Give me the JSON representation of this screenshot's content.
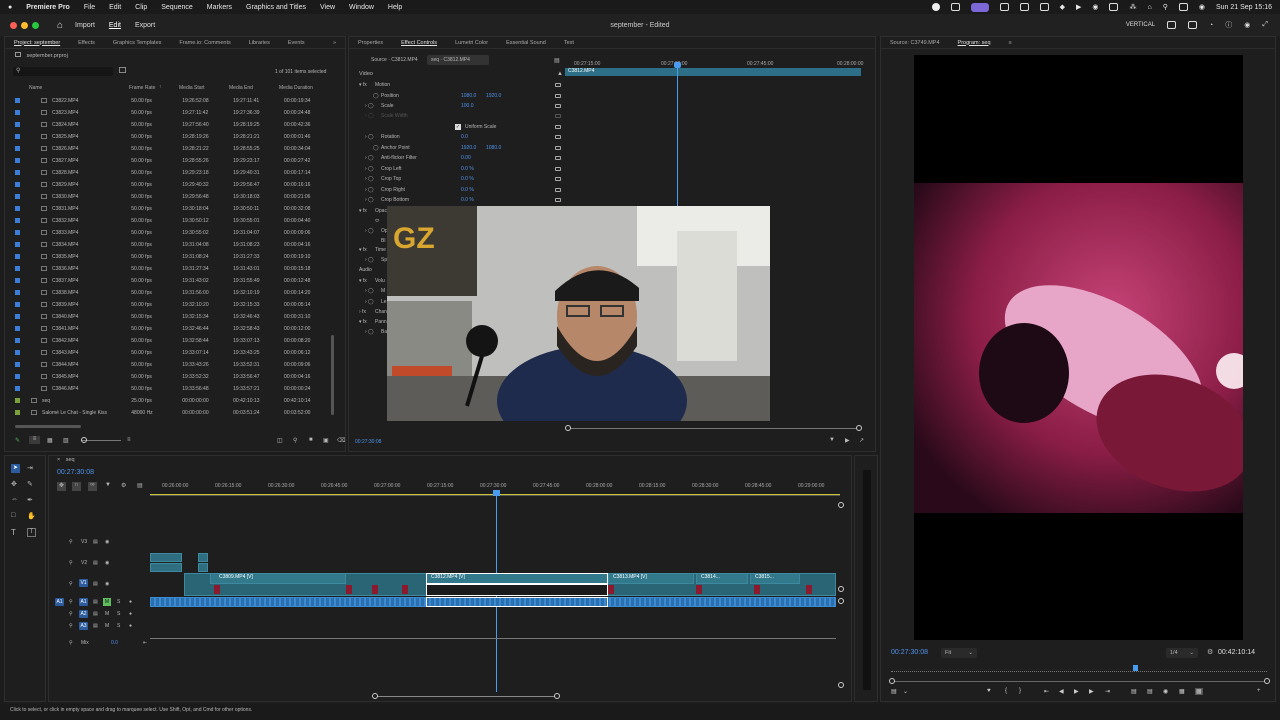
{
  "menubar": {
    "app": "Premiere Pro",
    "items": [
      "File",
      "Edit",
      "Clip",
      "Sequence",
      "Markers",
      "Graphics and Titles",
      "View",
      "Window",
      "Help"
    ],
    "clock": "Sun 21 Sep  15:16"
  },
  "titlebar": {
    "workspaces": [
      "Import",
      "Edit",
      "Export"
    ],
    "active_workspace": "Edit",
    "title": "september - Edited",
    "layout_label": "VERTICAL"
  },
  "project": {
    "tabs": [
      "Project: september",
      "Effects",
      "Graphics Templates",
      "Frame.io: Comments",
      "Libraries",
      "Events"
    ],
    "file": "september.prproj",
    "items_count": "1 of 101 items selected",
    "columns": [
      "Name",
      "Frame Rate",
      "Media Start",
      "Media End",
      "Media Duration"
    ],
    "rows": [
      [
        "C3822.MP4",
        "50.00 fps",
        "19:26:52:08",
        "19:27:11:41",
        "00:00:19:34"
      ],
      [
        "C3823.MP4",
        "50.00 fps",
        "19:27:11:42",
        "19:27:36:39",
        "00:00:24:48"
      ],
      [
        "C3824.MP4",
        "50.00 fps",
        "19:27:56:40",
        "19:28:19:25",
        "00:00:42:36"
      ],
      [
        "C3825.MP4",
        "50.00 fps",
        "19:28:19:26",
        "19:28:21:21",
        "00:00:01:46"
      ],
      [
        "C3826.MP4",
        "50.00 fps",
        "19:28:21:22",
        "19:28:55:25",
        "00:00:34:04"
      ],
      [
        "C3827.MP4",
        "50.00 fps",
        "19:28:55:26",
        "19:29:23:17",
        "00:00:27:42"
      ],
      [
        "C3828.MP4",
        "50.00 fps",
        "19:29:23:18",
        "19:29:40:31",
        "00:00:17:14"
      ],
      [
        "C3829.MP4",
        "50.00 fps",
        "19:29:40:32",
        "19:29:56:47",
        "00:00:16:16"
      ],
      [
        "C3830.MP4",
        "50.00 fps",
        "19:29:56:48",
        "19:30:18:03",
        "00:00:21:06"
      ],
      [
        "C3831.MP4",
        "50.00 fps",
        "19:30:18:04",
        "19:30:50:11",
        "00:00:32:08"
      ],
      [
        "C3832.MP4",
        "50.00 fps",
        "19:30:50:12",
        "19:30:55:01",
        "00:00:04:40"
      ],
      [
        "C3833.MP4",
        "50.00 fps",
        "19:30:55:02",
        "19:31:04:07",
        "00:00:09:06"
      ],
      [
        "C3834.MP4",
        "50.00 fps",
        "19:31:04:08",
        "19:31:08:23",
        "00:00:04:16"
      ],
      [
        "C3835.MP4",
        "50.00 fps",
        "19:31:08:24",
        "19:31:27:33",
        "00:00:19:10"
      ],
      [
        "C3836.MP4",
        "50.00 fps",
        "19:31:27:34",
        "19:31:43:01",
        "00:00:15:18"
      ],
      [
        "C3837.MP4",
        "50.00 fps",
        "19:31:43:02",
        "19:31:55:49",
        "00:00:12:48"
      ],
      [
        "C3838.MP4",
        "50.00 fps",
        "19:31:56:00",
        "19:32:10:19",
        "00:00:14:20"
      ],
      [
        "C3839.MP4",
        "50.00 fps",
        "19:32:10:20",
        "19:32:15:33",
        "00:00:05:14"
      ],
      [
        "C3840.MP4",
        "50.00 fps",
        "19:32:15:34",
        "19:32:46:43",
        "00:00:31:10"
      ],
      [
        "C3841.MP4",
        "50.00 fps",
        "19:32:46:44",
        "19:32:58:43",
        "00:00:12:00"
      ],
      [
        "C3842.MP4",
        "50.00 fps",
        "19:32:58:44",
        "19:33:07:13",
        "00:00:08:20"
      ],
      [
        "C3843.MP4",
        "50.00 fps",
        "19:33:07:14",
        "19:33:43:25",
        "00:00:06:12"
      ],
      [
        "C3844.MP4",
        "50.00 fps",
        "19:33:43:26",
        "19:33:52:31",
        "00:00:09:06"
      ],
      [
        "C3845.MP4",
        "50.00 fps",
        "19:33:52:32",
        "19:33:56:47",
        "00:00:04:16"
      ],
      [
        "C3846.MP4",
        "50.00 fps",
        "19:33:56:48",
        "19:33:57:21",
        "00:00:00:24"
      ],
      [
        "seq",
        "25.00 fps",
        "00:00:00:00",
        "00:42:10:13",
        "00:42:10:14"
      ],
      [
        "Salomé Le Chat - Single Kiss",
        "48000 Hz",
        "00:00:00:00",
        "00:03:51:24",
        "00:03:52:00"
      ]
    ]
  },
  "effect_controls": {
    "tabs": [
      "Properties",
      "Effect Controls",
      "Lumetri Color",
      "Essential Sound",
      "Text"
    ],
    "source_tab": "Source · C3812.MP4",
    "seq_tab": "seq · C3812.MP4",
    "clip_label": "C3812.MP4",
    "ruler": [
      "00:27:15:00",
      "00:27:30:00",
      "00:27:45:00",
      "00:28:00:00"
    ],
    "section_video": "Video",
    "section_audio": "Audio",
    "motion": "Motion",
    "position_label": "Position",
    "position_x": "1080.0",
    "position_y": "1920.0",
    "scale_label": "Scale",
    "scale_value": "100.0",
    "scale_width_label": "Scale Width",
    "uniform_scale": "Uniform Scale",
    "rotation_label": "Rotation",
    "rotation_value": "0.0",
    "anchor_label": "Anchor Point",
    "anchor_x": "1920.0",
    "anchor_y": "1080.0",
    "antiflicker_label": "Anti-flicker Filter",
    "antiflicker_value": "0.00",
    "crop_left_label": "Crop Left",
    "crop_left_value": "0.0 %",
    "crop_top_label": "Crop Top",
    "crop_top_value": "0.0 %",
    "crop_right_label": "Crop Right",
    "crop_right_value": "0.0 %",
    "crop_bottom_label": "Crop Bottom",
    "crop_bottom_value": "0.0 %",
    "opacity_label": "Opac",
    "op_label": "Op",
    "bl_label": "Bl",
    "time_label": "Time",
    "sp_label": "Sp",
    "volume_label": "Volu",
    "m_label": "M",
    "le_label": "Le",
    "chan_label": "Chan",
    "pann_label": "Pann",
    "ba_label": "Ba",
    "timecode": "00:27:30:08"
  },
  "program": {
    "source_tab": "Source: C3749.MP4",
    "program_tab": "Program: seq",
    "timecode": "00:27:30:08",
    "fit": "Fit",
    "resolution": "1/4",
    "duration": "00:42:10:14"
  },
  "timeline": {
    "seq_tab": "seq",
    "timecode": "00:27:30:08",
    "ruler": [
      "00:26:00:00",
      "00:26:15:00",
      "00:26:30:00",
      "00:26:45:00",
      "00:27:00:00",
      "00:27:15:00",
      "00:27:30:00",
      "00:27:45:00",
      "00:28:00:00",
      "00:28:15:00",
      "00:28:30:00",
      "00:28:45:00",
      "00:29:00:00"
    ],
    "tracks": [
      "V3",
      "V2",
      "V1",
      "A1",
      "A2",
      "A3"
    ],
    "mix_label": "Mix",
    "mix_value": "0.0",
    "clips": [
      "C3809.MP4 [V]",
      "C3812.MP4 [V]",
      "C3813.MP4 [V]",
      "C3814...",
      "C3815..."
    ]
  },
  "statusbar": "Click to select, or click in empty space and drag to marquee select. Use Shift, Opt, and Cmd for other options."
}
